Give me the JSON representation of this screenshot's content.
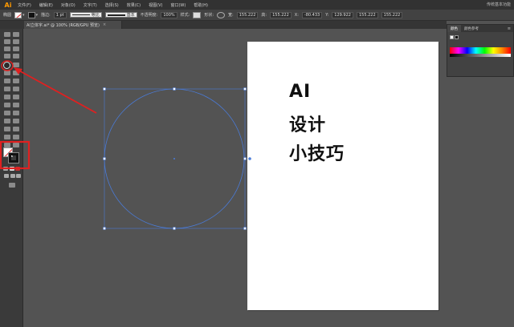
{
  "app": {
    "logo": "Ai",
    "workspace": "传统基本功能"
  },
  "menu": {
    "items": [
      "文件(F)",
      "编辑(E)",
      "对象(O)",
      "文字(T)",
      "选择(S)",
      "效果(C)",
      "视图(V)",
      "窗口(W)",
      "帮助(H)"
    ]
  },
  "control_bar": {
    "selection_label": "椭圆",
    "stroke_label": "描边:",
    "stroke_weight": "1 pt",
    "profile_label": "等比",
    "brush_label": "基本",
    "opacity_label": "不透明度:",
    "opacity_value": "100%",
    "style_label": "样式:",
    "shape_label": "形状:",
    "w_label": "宽:",
    "w_value": "155.222",
    "h_label": "高:",
    "h_value": "155.222",
    "x_label": "X:",
    "x_value": "-80.433",
    "y_label": "Y:",
    "y_value": "129.922",
    "w2_value": "155.222",
    "h2_value": "155.222"
  },
  "document_tab": {
    "title": "AI立体字.ai* @ 100% (RGB/GPU 预览)",
    "close": "×"
  },
  "canvas": {
    "text_lines": [
      "AI",
      "设计",
      "小技巧"
    ]
  },
  "panel": {
    "tabs": [
      "颜色",
      "颜色参考"
    ],
    "menu_icon": "≡"
  },
  "colors": {
    "annotation": "#e02020",
    "selection": "#4a7bd8",
    "ui_dark": "#323232",
    "canvas_bg": "#535353"
  }
}
